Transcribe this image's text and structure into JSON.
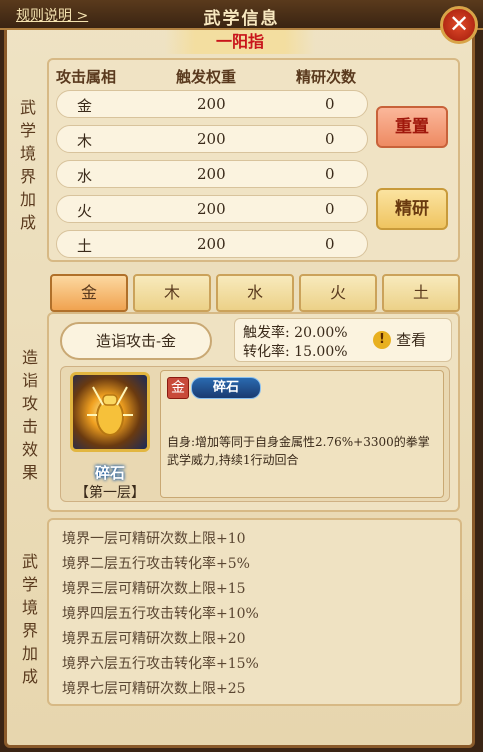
{
  "header": {
    "rules_link": "规则说明 >",
    "title": "武学信息",
    "close_icon": "close-x-icon"
  },
  "skill_name": "一阳指",
  "section_labels": {
    "realm_bonus": "武学境界加成",
    "mastery_effect": "造诣攻击效果",
    "realm_bonus_2": "武学境界加成"
  },
  "table": {
    "headers": [
      "攻击属相",
      "触发权重",
      "精研次数"
    ],
    "rows": [
      {
        "element": "金",
        "weight": "200",
        "count": "0"
      },
      {
        "element": "木",
        "weight": "200",
        "count": "0"
      },
      {
        "element": "水",
        "weight": "200",
        "count": "0"
      },
      {
        "element": "火",
        "weight": "200",
        "count": "0"
      },
      {
        "element": "土",
        "weight": "200",
        "count": "0"
      }
    ]
  },
  "buttons": {
    "reset": "重置",
    "refine": "精研"
  },
  "tabs": [
    "金",
    "木",
    "水",
    "火",
    "土"
  ],
  "active_tab": "金",
  "attack": {
    "label": "造诣攻击-金",
    "trigger_rate": "触发率: 20.00%",
    "convert_rate": "转化率: 15.00%",
    "view": "查看",
    "view_icon": "exclamation-circle-icon"
  },
  "skill": {
    "name": "碎石",
    "layer": "【第一层】",
    "element_tag": "金",
    "tag_name": "碎石",
    "description": "自身:增加等同于自身金属性2.76%+3300的拳掌武学威力,持续1行动回合",
    "icon": "golden-fist-icon"
  },
  "realm_levels": [
    "境界一层可精研次数上限+10",
    "境界二层五行攻击转化率+5%",
    "境界三层可精研次数上限+15",
    "境界四层五行攻击转化率+10%",
    "境界五层可精研次数上限+20",
    "境界六层五行攻击转化率+15%",
    "境界七层可精研次数上限+25"
  ],
  "colors": {
    "accent_red": "#c8141a",
    "reset_btn": "#f29c7a",
    "refine_btn": "#f2d07a",
    "panel_bg": "#efe3c4"
  }
}
